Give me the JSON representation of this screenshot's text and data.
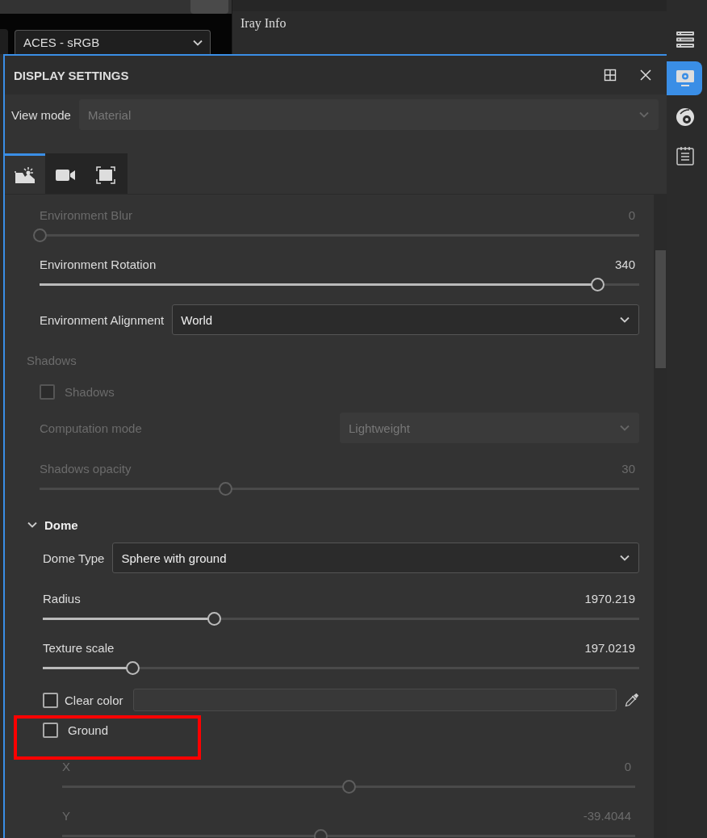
{
  "toolbar": {
    "color_profile": "ACES - sRGB"
  },
  "info_panel": {
    "title": "Iray Info"
  },
  "side_bar": {
    "items": [
      {
        "kind": "list",
        "selected": false
      },
      {
        "kind": "display",
        "selected": true
      },
      {
        "kind": "environment",
        "selected": false
      },
      {
        "kind": "notes",
        "selected": false
      }
    ]
  },
  "panel": {
    "title": "DISPLAY SETTINGS",
    "view_mode": {
      "label": "View mode",
      "value": "Material",
      "disabled": true
    },
    "tabs": [
      {
        "kind": "picture",
        "selected": true
      },
      {
        "kind": "camera",
        "selected": false
      },
      {
        "kind": "frame",
        "selected": false
      }
    ],
    "settings": [
      {
        "kind": "slider",
        "label": "Environment Blur",
        "reading": "0",
        "level": 0,
        "disabled": true
      },
      {
        "kind": "slider",
        "label": "Environment Rotation",
        "reading": "340",
        "level": 0.93,
        "disabled": false
      },
      {
        "kind": "select",
        "label": "Environment Alignment",
        "value": "World",
        "disabled": false
      },
      {
        "kind": "heading",
        "label": "Shadows",
        "disabled": true
      },
      {
        "kind": "checkbox",
        "label": "Shadows",
        "checked": false,
        "disabled": true
      },
      {
        "kind": "select",
        "label": "Computation mode",
        "value": "Lightweight",
        "disabled": true
      },
      {
        "kind": "slider",
        "label": "Shadows opacity",
        "reading": "30",
        "level": 0.31,
        "disabled": true
      },
      {
        "kind": "section",
        "label": "Dome",
        "expanded": true,
        "children": [
          {
            "kind": "select",
            "label": "Dome Type",
            "value": "Sphere with ground",
            "disabled": false
          },
          {
            "kind": "slider",
            "label": "Radius",
            "reading": "1970.219",
            "level": 0.287,
            "disabled": false
          },
          {
            "kind": "slider",
            "label": "Texture scale",
            "reading": "197.0219",
            "level": 0.15,
            "disabled": false
          },
          {
            "kind": "color",
            "label": "Clear color",
            "checked": false,
            "disabled": false
          },
          {
            "kind": "checkbox",
            "label": "Ground",
            "checked": false,
            "disabled": false,
            "highlighted": true,
            "children": [
              {
                "kind": "slider",
                "label": "X",
                "reading": "0",
                "level": 0.5,
                "disabled": true
              },
              {
                "kind": "slider",
                "label": "Y",
                "reading": "-39.4044",
                "level": 0.45,
                "disabled": true
              }
            ]
          }
        ]
      }
    ]
  }
}
